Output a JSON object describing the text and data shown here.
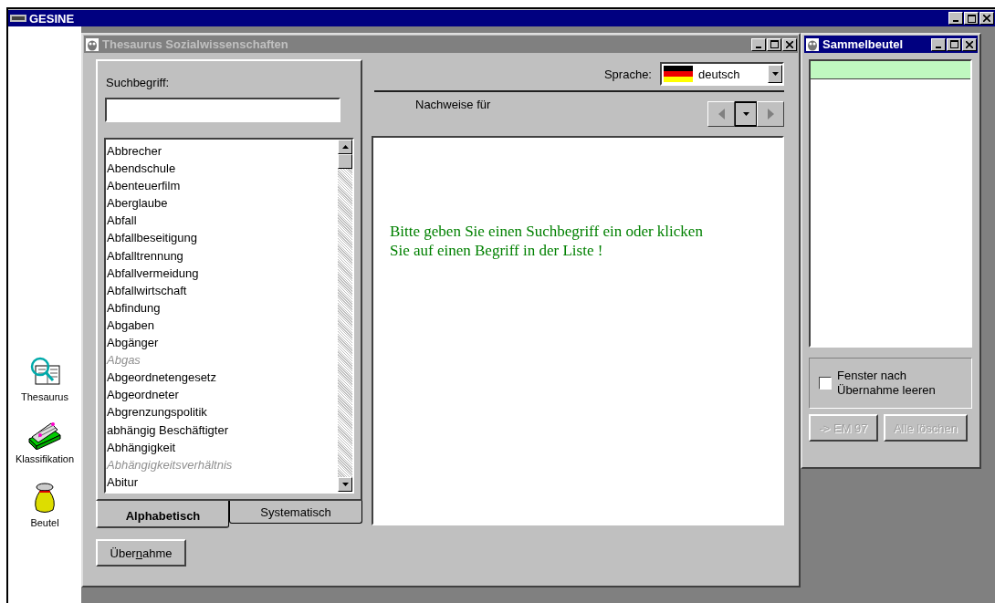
{
  "app_window": {
    "title": "GESINE"
  },
  "sidebar": {
    "items": [
      {
        "label": "Thesaurus",
        "kind": "thesaurus"
      },
      {
        "label": "Klassifikation",
        "kind": "classification"
      },
      {
        "label": "Beutel",
        "kind": "bag"
      }
    ]
  },
  "thesaurus_window": {
    "title": "Thesaurus Sozialwissenschaften",
    "active": false,
    "search": {
      "label": "Suchbegriff:"
    },
    "terms": [
      {
        "label": "Abbrecher",
        "kind": "descriptor"
      },
      {
        "label": "Abendschule",
        "kind": "descriptor"
      },
      {
        "label": "Abenteuerfilm",
        "kind": "descriptor"
      },
      {
        "label": "Aberglaube",
        "kind": "descriptor"
      },
      {
        "label": "Abfall",
        "kind": "descriptor"
      },
      {
        "label": "Abfallbeseitigung",
        "kind": "descriptor"
      },
      {
        "label": "Abfalltrennung",
        "kind": "descriptor"
      },
      {
        "label": "Abfallvermeidung",
        "kind": "descriptor"
      },
      {
        "label": "Abfallwirtschaft",
        "kind": "descriptor"
      },
      {
        "label": "Abfindung",
        "kind": "descriptor"
      },
      {
        "label": "Abgaben",
        "kind": "descriptor"
      },
      {
        "label": "Abgänger",
        "kind": "descriptor"
      },
      {
        "label": "Abgas",
        "kind": "non_descriptor"
      },
      {
        "label": "Abgeordnetengesetz",
        "kind": "descriptor"
      },
      {
        "label": "Abgeordneter",
        "kind": "descriptor"
      },
      {
        "label": "Abgrenzungspolitik",
        "kind": "descriptor"
      },
      {
        "label": "abhängig Beschäftigter",
        "kind": "descriptor"
      },
      {
        "label": "Abhängigkeit",
        "kind": "descriptor"
      },
      {
        "label": "Abhängigkeitsverhältnis",
        "kind": "non_descriptor"
      },
      {
        "label": "Abitur",
        "kind": "descriptor"
      }
    ],
    "tabs": [
      {
        "label": "Alphabetisch",
        "selected": true
      },
      {
        "label": "Systematisch",
        "selected": false
      }
    ],
    "accept_button": {
      "before": "Über",
      "mnemonic": "n",
      "after": "ahme"
    },
    "language": {
      "label": "Sprache:",
      "value": "deutsch"
    },
    "results_label": "Nachweise für",
    "nav_buttons": [
      {
        "kind": "prev",
        "disabled": true
      },
      {
        "kind": "menu",
        "disabled": false
      },
      {
        "kind": "next",
        "disabled": true
      }
    ],
    "message": "Bitte geben Sie einen Suchbegriff ein oder klicken Sie auf einen Begriff in der Liste !"
  },
  "collection_window": {
    "title": "Sammelbeutel",
    "active": true,
    "checkbox": {
      "label": "Fenster nach Übernahme leeren",
      "checked": false
    },
    "buttons": [
      {
        "label": "-> EM 97",
        "disabled": true
      },
      {
        "label": "Alle löschen",
        "disabled": true
      }
    ]
  }
}
